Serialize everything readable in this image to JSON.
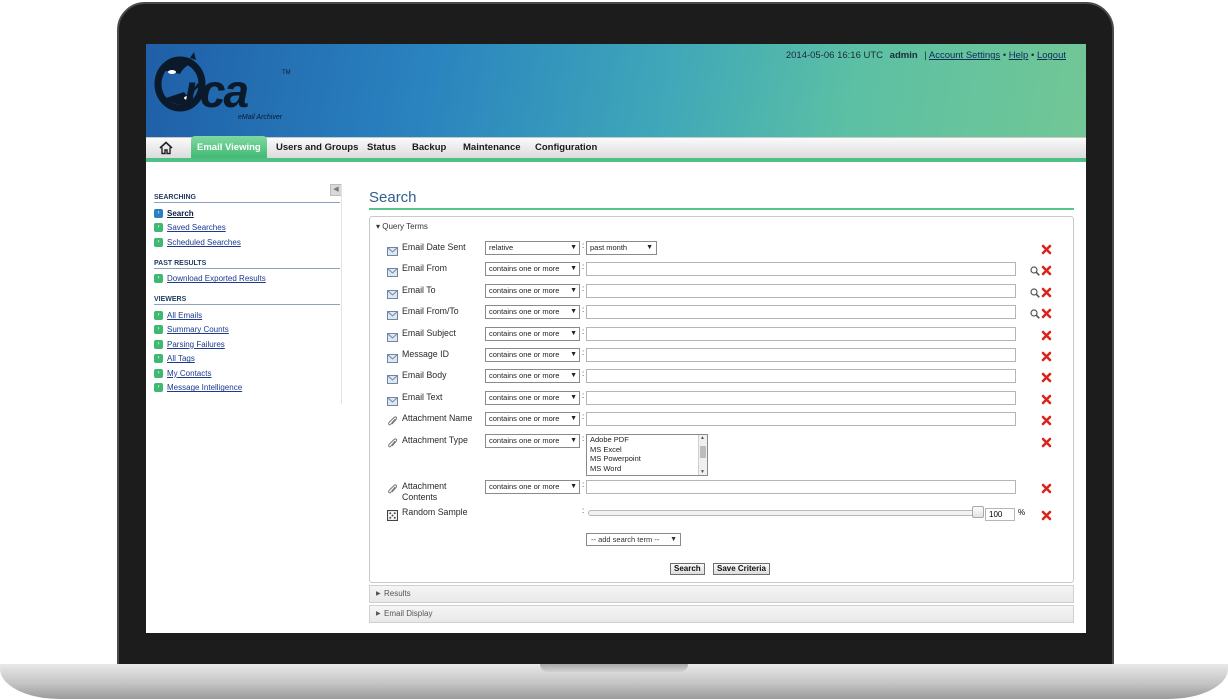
{
  "app": {
    "logo_text": "rca",
    "logo_sub": "eMail Archiver",
    "logo_tm": "TM"
  },
  "topbar": {
    "datetime": "2014-05-06 16:16 UTC",
    "user": "admin",
    "sep": "|",
    "links": [
      "Account Settings",
      "Help",
      "Logout"
    ],
    "bullet": "•"
  },
  "nav": {
    "items": [
      "Email Viewing",
      "Users and Groups",
      "Status",
      "Backup",
      "Maintenance",
      "Configuration"
    ],
    "active": "Email Viewing"
  },
  "sidebar": {
    "collapse_glyph": "◀",
    "sections": [
      {
        "title": "SEARCHING",
        "items": [
          "Search",
          "Saved Searches",
          "Scheduled Searches"
        ]
      },
      {
        "title": "PAST RESULTS",
        "items": [
          "Download Exported Results"
        ]
      },
      {
        "title": "VIEWERS",
        "items": [
          "All Emails",
          "Summary Counts",
          "Parsing Failures",
          "All Tags",
          "My Contacts",
          "Message Intelligence"
        ]
      }
    ],
    "current": "Search"
  },
  "main": {
    "title": "Search",
    "query_terms_label": "Query Terms",
    "rows": [
      {
        "label": "Email Date Sent",
        "icon": "envelope-icon",
        "operator": "relative",
        "value_select": "past month",
        "search": false
      },
      {
        "label": "Email From",
        "icon": "envelope-icon",
        "operator": "contains one or more",
        "search": true
      },
      {
        "label": "Email To",
        "icon": "envelope-icon",
        "operator": "contains one or more",
        "search": true
      },
      {
        "label": "Email From/To",
        "icon": "envelope-icon",
        "operator": "contains one or more",
        "search": true
      },
      {
        "label": "Email Subject",
        "icon": "envelope-icon",
        "operator": "contains one or more",
        "search": false
      },
      {
        "label": "Message ID",
        "icon": "envelope-icon",
        "operator": "contains one or more",
        "search": false
      },
      {
        "label": "Email Body",
        "icon": "envelope-icon",
        "operator": "contains one or more",
        "search": false
      },
      {
        "label": "Email Text",
        "icon": "envelope-icon",
        "operator": "contains one or more",
        "search": false
      },
      {
        "label": "Attachment Name",
        "icon": "paperclip-icon",
        "operator": "contains one or more",
        "search": false
      },
      {
        "label": "Attachment Type",
        "icon": "paperclip-icon",
        "operator": "contains one or more",
        "search": false
      },
      {
        "label": "Attachment Contents",
        "icon": "paperclip-icon",
        "operator": "contains one or more",
        "search": false
      },
      {
        "label": "Random Sample",
        "icon": "dice-icon",
        "search": false
      }
    ],
    "attachment_types": [
      "Adobe PDF",
      "MS Excel",
      "MS Powerpoint",
      "MS Word"
    ],
    "random_sample_value": "100",
    "random_sample_fraction": 1.0,
    "percent_sign": "%",
    "colon": ":",
    "add_term": "-- add search term --",
    "search_button": "Search",
    "save_button": "Save Criteria",
    "collapsed_sections": [
      "Results",
      "Email Display"
    ]
  },
  "colors": {
    "accent_green": "#4fbf83",
    "delete_red": "#d9261c",
    "title_blue": "#2f5f8f"
  }
}
